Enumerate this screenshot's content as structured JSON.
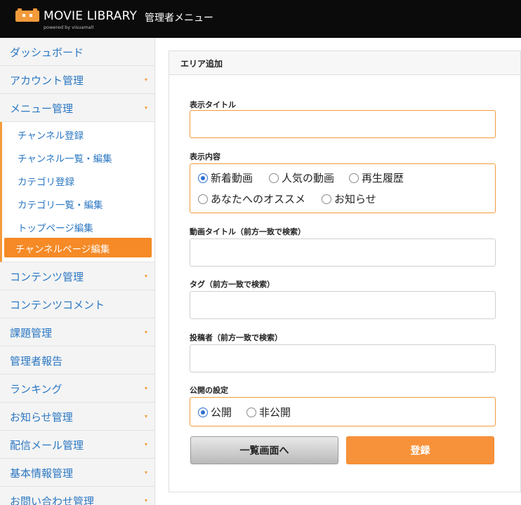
{
  "header": {
    "logo_title": "MOVIE LIBRARY",
    "logo_subtitle": "powered by visuamall",
    "admin_menu": "管理者メニュー",
    "logo_color": "#f39b3b"
  },
  "sidebar": {
    "items": [
      {
        "label": "ダッシュボード",
        "has_arrow": false
      },
      {
        "label": "アカウント管理",
        "has_arrow": true
      },
      {
        "label": "メニュー管理",
        "has_arrow": true
      }
    ],
    "submenu": [
      {
        "label": "チャンネル登録",
        "active": false
      },
      {
        "label": "チャンネル一覧・編集",
        "active": false
      },
      {
        "label": "カテゴリ登録",
        "active": false
      },
      {
        "label": "カテゴリ一覧・編集",
        "active": false
      },
      {
        "label": "トップページ編集",
        "active": false
      },
      {
        "label": "チャンネルページ編集",
        "active": true
      }
    ],
    "items_after": [
      {
        "label": "コンテンツ管理",
        "has_arrow": true
      },
      {
        "label": "コンテンツコメント",
        "has_arrow": false
      },
      {
        "label": "課題管理",
        "has_arrow": true
      },
      {
        "label": "管理者報告",
        "has_arrow": false
      },
      {
        "label": "ランキング",
        "has_arrow": true
      },
      {
        "label": "お知らせ管理",
        "has_arrow": true
      },
      {
        "label": "配信メール管理",
        "has_arrow": true
      },
      {
        "label": "基本情報管理",
        "has_arrow": true
      },
      {
        "label": "お問い合わせ管理",
        "has_arrow": true
      }
    ],
    "accent_color": "#f58a26",
    "link_color": "#2b77c2"
  },
  "form": {
    "panel_title": "エリア追加",
    "display_title": {
      "label": "表示タイトル",
      "value": ""
    },
    "display_content": {
      "label": "表示内容",
      "options": [
        "新着動画",
        "人気の動画",
        "再生履歴",
        "あなたへのオススメ",
        "お知らせ"
      ],
      "selected": "新着動画"
    },
    "video_title": {
      "label": "動画タイトル（前方一致で検索）",
      "value": ""
    },
    "tag": {
      "label": "タグ（前方一致で検索）",
      "value": ""
    },
    "poster": {
      "label": "投稿者（前方一致で検索）",
      "value": ""
    },
    "visibility": {
      "label": "公開の設定",
      "options": [
        "公開",
        "非公開"
      ],
      "selected": "公開"
    },
    "back_button": "一覧画面へ",
    "submit_button": "登録"
  }
}
